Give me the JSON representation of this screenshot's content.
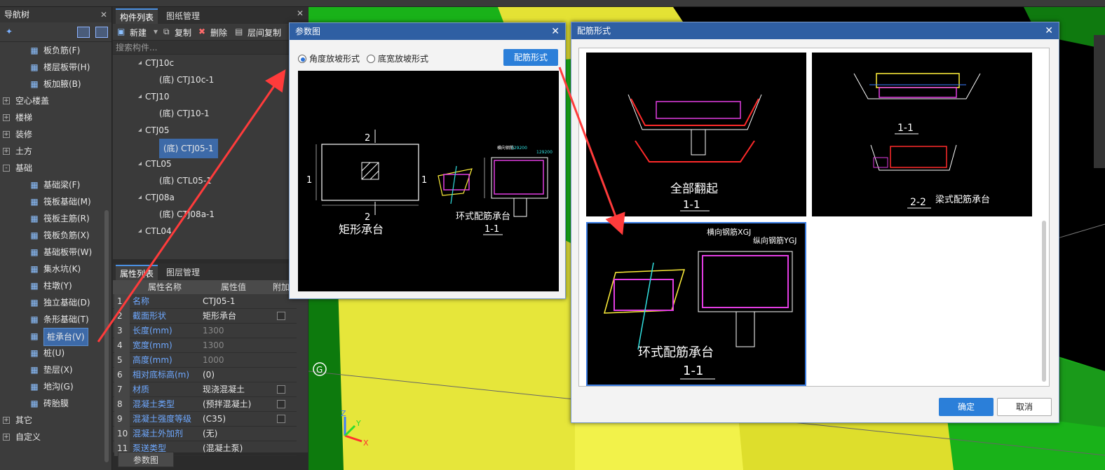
{
  "nav": {
    "title": "导航树",
    "items": [
      {
        "label": "板负筋(F)",
        "icon": "slab-rebar-icon",
        "level": 1,
        "exp": ""
      },
      {
        "label": "楼层板带(H)",
        "icon": "strip-icon",
        "level": 1,
        "exp": ""
      },
      {
        "label": "板加腋(B)",
        "icon": "haunch-icon",
        "level": 1,
        "exp": ""
      },
      {
        "label": "空心楼盖",
        "icon": "",
        "level": 0,
        "exp": "+"
      },
      {
        "label": "楼梯",
        "icon": "",
        "level": 0,
        "exp": "+"
      },
      {
        "label": "装修",
        "icon": "",
        "level": 0,
        "exp": "+"
      },
      {
        "label": "土方",
        "icon": "",
        "level": 0,
        "exp": "+"
      },
      {
        "label": "基础",
        "icon": "",
        "level": 0,
        "exp": "-"
      },
      {
        "label": "基础梁(F)",
        "icon": "beam-icon",
        "level": 1,
        "exp": ""
      },
      {
        "label": "筏板基础(M)",
        "icon": "raft-icon",
        "level": 1,
        "exp": ""
      },
      {
        "label": "筏板主筋(R)",
        "icon": "raft-main-icon",
        "level": 1,
        "exp": ""
      },
      {
        "label": "筏板负筋(X)",
        "icon": "raft-neg-icon",
        "level": 1,
        "exp": ""
      },
      {
        "label": "基础板带(W)",
        "icon": "found-strip-icon",
        "level": 1,
        "exp": ""
      },
      {
        "label": "集水坑(K)",
        "icon": "sump-icon",
        "level": 1,
        "exp": ""
      },
      {
        "label": "柱墩(Y)",
        "icon": "pier-icon",
        "level": 1,
        "exp": ""
      },
      {
        "label": "独立基础(D)",
        "icon": "isolated-found-icon",
        "level": 1,
        "exp": ""
      },
      {
        "label": "条形基础(T)",
        "icon": "strip-found-icon",
        "level": 1,
        "exp": ""
      },
      {
        "label": "桩承台(V)",
        "icon": "pile-cap-icon",
        "level": 1,
        "exp": "",
        "sel": true
      },
      {
        "label": "桩(U)",
        "icon": "pile-icon",
        "level": 1,
        "exp": ""
      },
      {
        "label": "垫层(X)",
        "icon": "cushion-icon",
        "level": 1,
        "exp": ""
      },
      {
        "label": "地沟(G)",
        "icon": "trench-icon",
        "level": 1,
        "exp": ""
      },
      {
        "label": "砖胎膜",
        "icon": "brick-mold-icon",
        "level": 1,
        "exp": ""
      },
      {
        "label": "其它",
        "icon": "",
        "level": 0,
        "exp": "+"
      },
      {
        "label": "自定义",
        "icon": "",
        "level": 0,
        "exp": "+"
      }
    ]
  },
  "components": {
    "tabs": [
      "构件列表",
      "图纸管理"
    ],
    "toolbar": {
      "new": "新建",
      "copy": "复制",
      "delete": "删除",
      "floor_copy": "层间复制"
    },
    "search_placeholder": "搜索构件...",
    "rows": [
      {
        "label": "CTJ10c",
        "level": 0
      },
      {
        "label": "(底) CTJ10c-1",
        "level": 1
      },
      {
        "label": "CTJ10",
        "level": 0
      },
      {
        "label": "(底) CTJ10-1",
        "level": 1
      },
      {
        "label": "CTJ05",
        "level": 0
      },
      {
        "label": "(底) CTJ05-1",
        "level": 1,
        "sel": true
      },
      {
        "label": "CTL05",
        "level": 0
      },
      {
        "label": "(底) CTL05-1",
        "level": 1
      },
      {
        "label": "CTJ08a",
        "level": 0
      },
      {
        "label": "(底) CTJ08a-1",
        "level": 1
      },
      {
        "label": "CTL04",
        "level": 0
      }
    ]
  },
  "properties": {
    "tabs": [
      "属性列表",
      "图层管理"
    ],
    "headers": [
      "属性名称",
      "属性值",
      "附加"
    ],
    "rows": [
      {
        "n": "1",
        "k": "名称",
        "v": "CTJ05-1",
        "cb": false,
        "gray": false
      },
      {
        "n": "2",
        "k": "截面形状",
        "v": "矩形承台",
        "cb": true,
        "gray": false
      },
      {
        "n": "3",
        "k": "长度(mm)",
        "v": "1300",
        "cb": false,
        "gray": true
      },
      {
        "n": "4",
        "k": "宽度(mm)",
        "v": "1300",
        "cb": false,
        "gray": true
      },
      {
        "n": "5",
        "k": "高度(mm)",
        "v": "1000",
        "cb": false,
        "gray": true
      },
      {
        "n": "6",
        "k": "相对底标高(m)",
        "v": "(0)",
        "cb": false,
        "gray": false
      },
      {
        "n": "7",
        "k": "材质",
        "v": "现浇混凝土",
        "cb": true,
        "gray": false
      },
      {
        "n": "8",
        "k": "混凝土类型",
        "v": "(预拌混凝土)",
        "cb": true,
        "gray": false
      },
      {
        "n": "9",
        "k": "混凝土强度等级",
        "v": "(C35)",
        "cb": true,
        "gray": false
      },
      {
        "n": "10",
        "k": "混凝土外加剂",
        "v": "(无)",
        "cb": false,
        "gray": false
      },
      {
        "n": "11",
        "k": "泵送类型",
        "v": "(混凝土泵)",
        "cb": false,
        "gray": false
      }
    ],
    "bottom_button": "参数图"
  },
  "param_dialog": {
    "title": "参数图",
    "radio1": "角度放坡形式",
    "radio2": "底宽放坡形式",
    "button": "配筋形式",
    "caption_left": "矩形承台",
    "caption_right": "环式配筋承台",
    "section": "1-1"
  },
  "rebar_dialog": {
    "title": "配筋形式",
    "thumb1_caption": "全部翻起",
    "thumb1_section": "1-1",
    "thumb2_section1": "1-1",
    "thumb2_section2": "2-2",
    "thumb2_caption": "梁式配筋承台",
    "thumb3_caption": "环式配筋承台",
    "thumb3_section": "1-1",
    "thumb3_label_h": "横向钢筋XGJ",
    "thumb3_label_v": "纵向钢筋YGJ",
    "ok": "确定",
    "cancel": "取消"
  },
  "viewport": {
    "g_marker": "G",
    "axis_x": "X",
    "axis_y": "Y",
    "axis_z": "Z"
  }
}
